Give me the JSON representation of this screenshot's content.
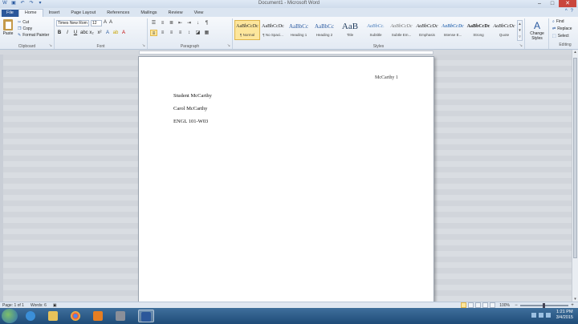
{
  "window": {
    "title": "Document1 - Microsoft Word"
  },
  "quick_access": {
    "save_icon": "save-icon",
    "undo_icon": "undo-icon",
    "redo_icon": "redo-icon"
  },
  "tabs": [
    "File",
    "Home",
    "Insert",
    "Page Layout",
    "References",
    "Mailings",
    "Review",
    "View"
  ],
  "active_tab": "Home",
  "clipboard": {
    "paste": "Paste",
    "cut": "Cut",
    "copy": "Copy",
    "format_painter": "Format Painter",
    "group": "Clipboard"
  },
  "font": {
    "name": "Times New Rom",
    "size": "12",
    "group": "Font"
  },
  "paragraph": {
    "group": "Paragraph"
  },
  "styles": {
    "group": "Styles",
    "items": [
      {
        "preview": "AaBbCcDc",
        "name": "¶ Normal"
      },
      {
        "preview": "AaBbCcDc",
        "name": "¶ No Spaci..."
      },
      {
        "preview": "AaBbCc",
        "name": "Heading 1"
      },
      {
        "preview": "AaBbCc",
        "name": "Heading 2"
      },
      {
        "preview": "AaB",
        "name": "Title"
      },
      {
        "preview": "AaBbCc.",
        "name": "Subtitle"
      },
      {
        "preview": "AaBbCcDc",
        "name": "Subtle Em..."
      },
      {
        "preview": "AaBbCcDc",
        "name": "Emphasis"
      },
      {
        "preview": "AaBbCcDc",
        "name": "Intense E..."
      },
      {
        "preview": "AaBbCcDc",
        "name": "Strong"
      },
      {
        "preview": "AaBbCcDc",
        "name": "Quote"
      }
    ],
    "change_styles": "Change Styles"
  },
  "editing": {
    "find": "Find",
    "replace": "Replace",
    "select": "Select",
    "group": "Editing"
  },
  "document": {
    "header": "McCarthy 1",
    "lines": [
      "Student McCarthy",
      "Carol McCarthy",
      "ENGL 101-W03"
    ]
  },
  "status": {
    "page": "Page: 1 of 1",
    "words": "Words: 6",
    "zoom": "100%"
  },
  "taskbar": {
    "time": "1:21 PM",
    "date": "3/4/2015"
  }
}
